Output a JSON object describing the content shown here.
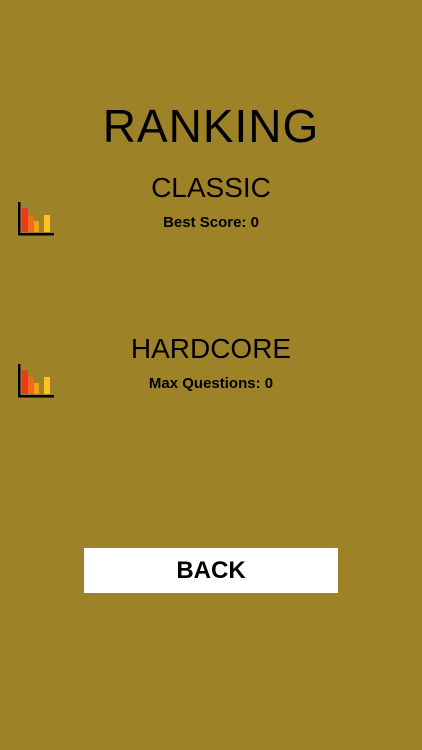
{
  "screen": {
    "title": "RANKING",
    "background_color": "#9E8228"
  },
  "modes": [
    {
      "name": "CLASSIC",
      "stat_label": "Best Score: 0",
      "icon": "bar-chart-icon"
    },
    {
      "name": "HARDCORE",
      "stat_label": "Max Questions: 0",
      "icon": "bar-chart-icon"
    }
  ],
  "back_button": {
    "label": "BACK",
    "background_color": "#FFFFFF"
  },
  "icon_colors": {
    "bar_red": "#E83A1C",
    "bar_orange": "#F26A1E",
    "bar_amber": "#F7A11A",
    "bar_yellow": "#F9C21C",
    "axis": "#000000"
  }
}
